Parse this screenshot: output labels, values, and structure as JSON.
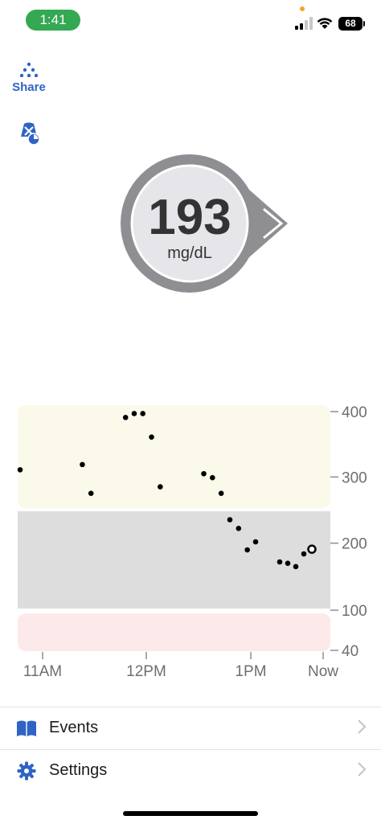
{
  "status_bar": {
    "time": "1:41",
    "battery": "68",
    "time_pill_color": "#34a853"
  },
  "toolbar": {
    "share_label": "Share",
    "share_icon": "share-dots-icon",
    "alert_icon": "alerts-muted-icon"
  },
  "reading": {
    "value": "193",
    "unit": "mg/dL",
    "trend": "steady-arrow-right"
  },
  "chart_data": {
    "type": "scatter",
    "x_tick_labels": [
      "11AM",
      "12PM",
      "1PM",
      "Now"
    ],
    "x_tick_minutes": [
      0,
      60,
      120,
      165
    ],
    "y_tick_labels": [
      "400",
      "300",
      "200",
      "100",
      "40"
    ],
    "y_tick_values": [
      400,
      300,
      200,
      100,
      40
    ],
    "ylim": [
      40,
      400
    ],
    "xlim": [
      -15,
      165
    ],
    "bands": [
      {
        "name": "high",
        "from": 250,
        "to": 400,
        "color": "#fbf9e9"
      },
      {
        "name": "in-range",
        "from": 100,
        "to": 250,
        "color": "#dddddd"
      },
      {
        "name": "low",
        "from": 40,
        "to": 100,
        "color": "#fce9e9"
      }
    ],
    "points": [
      {
        "x": -13,
        "y": 311
      },
      {
        "x": 23,
        "y": 319
      },
      {
        "x": 28,
        "y": 275
      },
      {
        "x": 48,
        "y": 391
      },
      {
        "x": 53,
        "y": 397
      },
      {
        "x": 58,
        "y": 397
      },
      {
        "x": 63,
        "y": 361
      },
      {
        "x": 68,
        "y": 285
      },
      {
        "x": 93,
        "y": 305
      },
      {
        "x": 98,
        "y": 299
      },
      {
        "x": 103,
        "y": 275
      },
      {
        "x": 108,
        "y": 235
      },
      {
        "x": 113,
        "y": 222
      },
      {
        "x": 118,
        "y": 190
      },
      {
        "x": 123,
        "y": 202
      },
      {
        "x": 138,
        "y": 172
      },
      {
        "x": 143,
        "y": 170
      },
      {
        "x": 148,
        "y": 165
      },
      {
        "x": 153,
        "y": 184
      },
      {
        "x": 158,
        "y": 191,
        "current": true
      }
    ]
  },
  "menu": [
    {
      "label": "Events",
      "icon": "book-icon"
    },
    {
      "label": "Settings",
      "icon": "gear-icon"
    }
  ],
  "colors": {
    "accent": "#2f64c4",
    "ring": "#8e8e93",
    "text": "#1c1c1e"
  }
}
